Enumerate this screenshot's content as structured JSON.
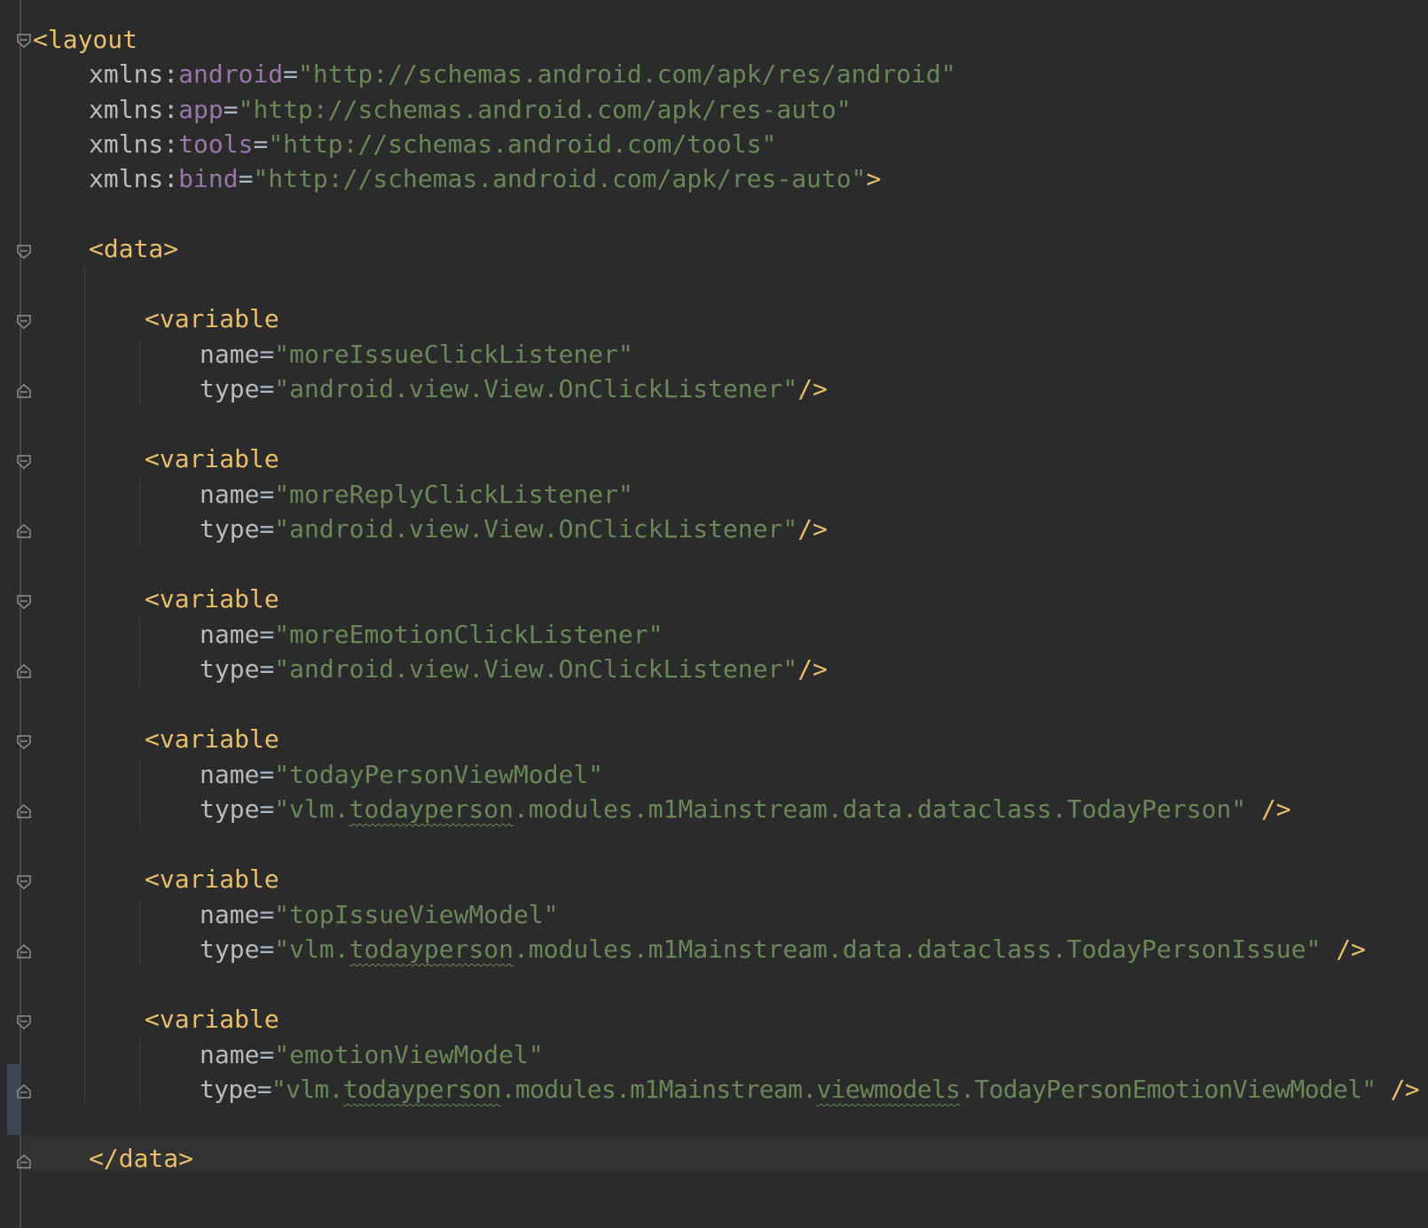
{
  "editor": {
    "layout_open": "<layout",
    "namespaces": [
      {
        "prefix": "xmlns:",
        "name": "android",
        "value": "\"http://schemas.android.com/apk/res/android\"",
        "end": ""
      },
      {
        "prefix": "xmlns:",
        "name": "app",
        "value": "\"http://schemas.android.com/apk/res-auto\"",
        "end": ""
      },
      {
        "prefix": "xmlns:",
        "name": "tools",
        "value": "\"http://schemas.android.com/tools\"",
        "end": ""
      },
      {
        "prefix": "xmlns:",
        "name": "bind",
        "value": "\"http://schemas.android.com/apk/res-auto\"",
        "end": ">"
      }
    ],
    "data_open": "<data>",
    "data_close": "</data>",
    "variable_open": "<variable",
    "variables": [
      {
        "name_attr": "name",
        "name_value": "\"moreIssueClickListener\"",
        "type_attr": "type",
        "type_parts": [
          "\"android.view.View.OnClickListener\"",
          "",
          "",
          "",
          "",
          ""
        ],
        "close": "/>"
      },
      {
        "name_attr": "name",
        "name_value": "\"moreReplyClickListener\"",
        "type_attr": "type",
        "type_parts": [
          "\"android.view.View.OnClickListener\"",
          "",
          "",
          "",
          "",
          ""
        ],
        "close": "/>"
      },
      {
        "name_attr": "name",
        "name_value": "\"moreEmotionClickListener\"",
        "type_attr": "type",
        "type_parts": [
          "\"android.view.View.OnClickListener\"",
          "",
          "",
          "",
          "",
          ""
        ],
        "close": "/>"
      },
      {
        "name_attr": "name",
        "name_value": "\"todayPersonViewModel\"",
        "type_attr": "type",
        "type_parts": [
          "\"vlm.",
          "todayperson",
          ".modules.m1Mainstream.data.dataclass.TodayPerson\"",
          "",
          "",
          ""
        ],
        "close": " />"
      },
      {
        "name_attr": "name",
        "name_value": "\"topIssueViewModel\"",
        "type_attr": "type",
        "type_parts": [
          "\"vlm.",
          "todayperson",
          ".modules.m1Mainstream.data.dataclass.TodayPersonIssue\"",
          "",
          "",
          ""
        ],
        "close": " />"
      },
      {
        "name_attr": "name",
        "name_value": "\"emotionViewModel\"",
        "type_attr": "type",
        "type_parts": [
          "\"vlm.",
          "todayperson",
          ".modules.m1Mainstream.",
          "viewmodels",
          ".TodayPersonEmotionViewModel\"",
          ""
        ],
        "close": " />"
      }
    ],
    "colors": {
      "background": "#2b2b2b",
      "tag": "#e8bf6a",
      "attribute": "#bababa",
      "namespace": "#9876aa",
      "string": "#6a8759"
    }
  }
}
